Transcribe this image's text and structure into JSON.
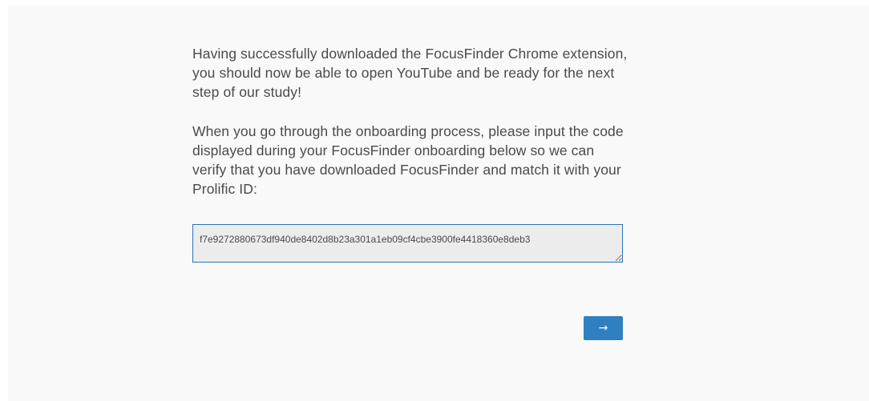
{
  "question": {
    "paragraph_1": "Having successfully downloaded the FocusFinder Chrome extension, you should now be able to open YouTube and be ready for the next step of our study!",
    "paragraph_2": "When you go through the onboarding process, please input the code displayed during your FocusFinder onboarding below so we can verify that you have downloaded FocusFinder and match it with your Prolific ID:"
  },
  "code_input": {
    "value": "f7e9272880673df940de8402d8b23a301a1eb09cf4cbe3900fe4418360e8deb3"
  },
  "navigation": {
    "next_label": "→"
  },
  "colors": {
    "accent": "#2f7fc1",
    "field_border": "#2f74b5",
    "background": "#f9f9f9"
  }
}
